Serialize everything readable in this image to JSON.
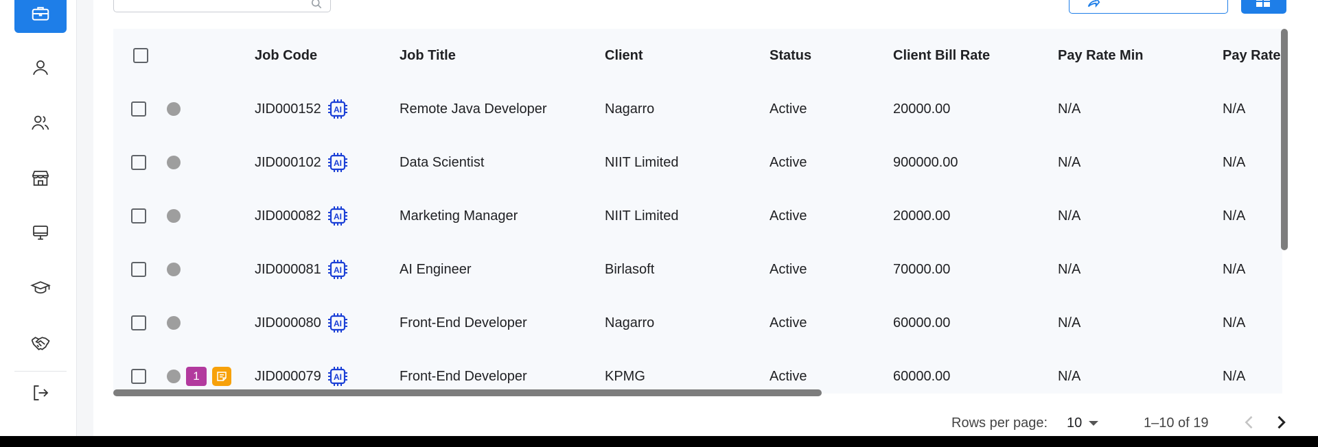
{
  "sidebar": {
    "items": [
      {
        "icon": "briefcase-icon",
        "active": true
      },
      {
        "icon": "user-icon",
        "active": false
      },
      {
        "icon": "users-icon",
        "active": false
      },
      {
        "icon": "store-icon",
        "active": false
      },
      {
        "icon": "monitor-icon",
        "active": false
      },
      {
        "icon": "graduation-cap-icon",
        "active": false
      },
      {
        "icon": "handshake-icon",
        "active": false
      }
    ],
    "logout_icon": "logout-icon"
  },
  "toolbar": {
    "search_icon": "search-icon",
    "action_icon": "share-icon",
    "view_icon": "grid-view-icon"
  },
  "table": {
    "columns": [
      "Job Code",
      "Job Title",
      "Client",
      "Status",
      "Client Bill Rate",
      "Pay Rate Min",
      "Pay Rate Max"
    ],
    "rows": [
      {
        "code": "JID000152",
        "title": "Remote Java Developer",
        "client": "Nagarro",
        "status": "Active",
        "bill": "20000.00",
        "min": "N/A",
        "max": "N/A"
      },
      {
        "code": "JID000102",
        "title": "Data Scientist",
        "client": "NIIT Limited",
        "status": "Active",
        "bill": "900000.00",
        "min": "N/A",
        "max": "N/A"
      },
      {
        "code": "JID000082",
        "title": "Marketing Manager",
        "client": "NIIT Limited",
        "status": "Active",
        "bill": "20000.00",
        "min": "N/A",
        "max": "N/A"
      },
      {
        "code": "JID000081",
        "title": "AI Engineer",
        "client": "Birlasoft",
        "status": "Active",
        "bill": "70000.00",
        "min": "N/A",
        "max": "N/A"
      },
      {
        "code": "JID000080",
        "title": "Front-End Developer",
        "client": "Nagarro",
        "status": "Active",
        "bill": "60000.00",
        "min": "N/A",
        "max": "N/A"
      },
      {
        "code": "JID000079",
        "title": "Front-End Developer",
        "client": "KPMG",
        "status": "Active",
        "bill": "60000.00",
        "min": "N/A",
        "max": "N/A",
        "count_badge": "1",
        "note_badge": true
      }
    ]
  },
  "pagination": {
    "rows_per_page_label": "Rows per page:",
    "rows_per_page_value": "10",
    "range": "1–10 of 19"
  },
  "colors": {
    "accent": "#1e7ee8",
    "ai_icon": "#1a3fd6",
    "count_badge": "#b23a9e",
    "note_badge": "#f7a10a"
  }
}
